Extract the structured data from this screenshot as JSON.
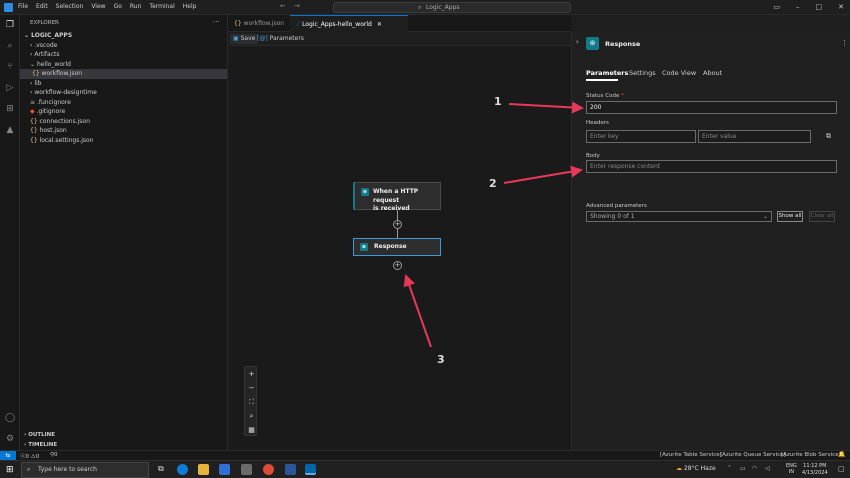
{
  "titlebar": {
    "menu": [
      "File",
      "Edit",
      "Selection",
      "View",
      "Go",
      "Run",
      "Terminal",
      "Help"
    ],
    "search": "Logic_Apps"
  },
  "explorer": {
    "header": "EXPLORER",
    "root": "LOGIC_APPS",
    "items": [
      ".vscode",
      "Artifacts",
      "hello_world",
      "workflow.json",
      "lib",
      "workflow-designtime",
      ".funcignore",
      ".gitignore",
      "connections.json",
      "host.json",
      "local.settings.json"
    ],
    "outline": "OUTLINE",
    "timeline": "TIMELINE"
  },
  "tabs": [
    {
      "label": "workflow.json"
    },
    {
      "label": "Logic_Apps-hello_world"
    }
  ],
  "toolbar": {
    "save": "Save",
    "parameters": "Parameters"
  },
  "canvas": {
    "trigger_node": "When a HTTP request is received",
    "trigger_line1": "When a HTTP request",
    "trigger_line2": "is received",
    "response_node": "Response"
  },
  "panel": {
    "title": "Response",
    "tabs": [
      "Parameters",
      "Settings",
      "Code View",
      "About"
    ],
    "status_code_label": "Status Code",
    "required_mark": "*",
    "status_code_value": "200",
    "headers_label": "Headers",
    "key_placeholder": "Enter key",
    "value_placeholder": "Enter value",
    "body_label": "Body",
    "body_placeholder": "Enter response content",
    "advanced_label": "Advanced parameters",
    "advanced_select": "Showing 0 of 1",
    "show_all": "Show all",
    "clear_all": "Clear all"
  },
  "annotations": [
    "1",
    "2",
    "3"
  ],
  "statusbar": {
    "left_errors": "0",
    "left_warnings": "0",
    "ports": "0",
    "azurite_table": "[Azurite Table Service]",
    "azurite_queue": "[Azurite Queue Service]",
    "azurite_blob": "[Azurite Blob Service]"
  },
  "taskbar": {
    "search_placeholder": "Type here to search",
    "weather": "28°C  Haze",
    "lang": "ENG",
    "region": "IN",
    "time": "11:12 PM",
    "date": "4/13/2024"
  },
  "colors": {
    "accent": "#0078d4",
    "arrow": "#e8385a",
    "node_icon": "#117a8b"
  }
}
